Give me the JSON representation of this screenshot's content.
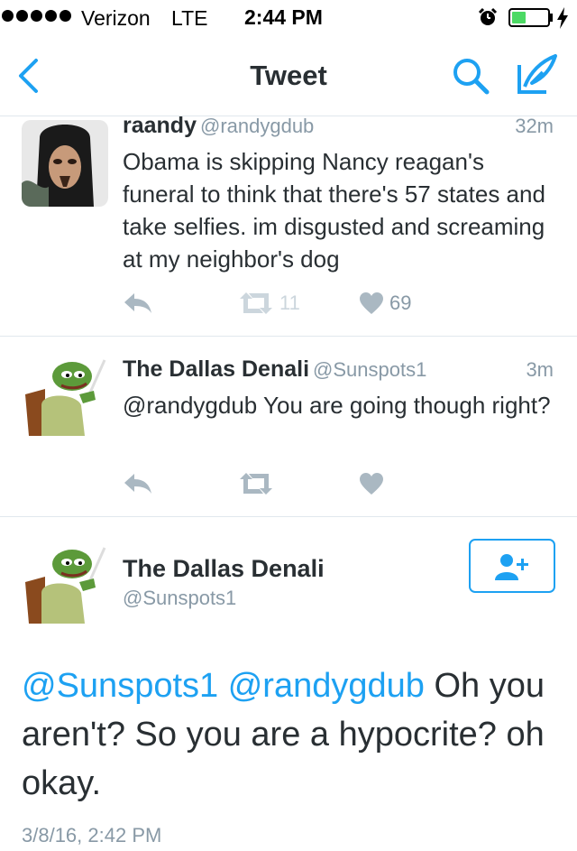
{
  "status_bar": {
    "carrier": "Verizon",
    "network": "LTE",
    "time": "2:44 PM",
    "battery_level": 0.4
  },
  "nav": {
    "title": "Tweet"
  },
  "tweets": [
    {
      "name": "raandy",
      "handle": "@randygdub",
      "time": "32m",
      "text": "Obama is skipping Nancy reagan's funeral to think that there's 57 states and take selfies. im disgusted and screaming at my neighbor's dog",
      "retweets": "11",
      "likes": "69"
    },
    {
      "name": "The Dallas Denali",
      "handle": "@Sunspots1",
      "time": "3m",
      "text": "@randygdub You are going though right?"
    }
  ],
  "main_tweet": {
    "name": "The Dallas Denali",
    "handle": "@Sunspots1",
    "mention_1": "@Sunspots1",
    "mention_2": "@randygdub",
    "text": "Oh you aren't? So you are a hypocrite? oh okay.",
    "date": "3/8/16, 2:42 PM"
  },
  "colors": {
    "accent": "#1da1f2",
    "muted": "#8899a6",
    "text": "#292f33",
    "divider": "#e1e8ed"
  },
  "icons": {
    "back": "chevron-left-icon",
    "search": "search-icon",
    "compose": "compose-feather-icon",
    "reply": "reply-icon",
    "retweet": "retweet-icon",
    "like": "heart-icon",
    "follow": "add-user-icon"
  }
}
